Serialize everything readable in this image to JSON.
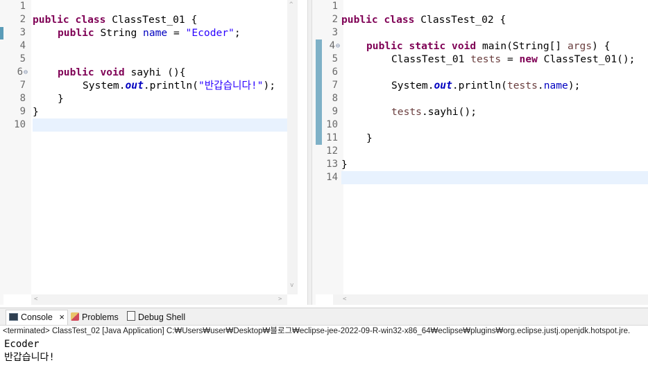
{
  "left_editor": {
    "line_numbers": [
      "1",
      "2",
      "3",
      "4",
      "5",
      "6",
      "7",
      "8",
      "9",
      "10"
    ],
    "code": {
      "l2": {
        "kw1": "public",
        "kw2": "class",
        "name": "ClassTest_01 {"
      },
      "l3": {
        "kw1": "public",
        "type": "String ",
        "field": "name",
        "eq": " = ",
        "str": "\"Ecoder\"",
        "end": ";"
      },
      "l6": {
        "kw1": "public",
        "kw2": "void",
        "rest": " sayhi (){"
      },
      "l7": {
        "obj": "System.",
        "sfield": "out",
        "call": ".println(",
        "str": "\"반갑습니다!\"",
        "end": ");"
      },
      "l8": "}",
      "l9": "}"
    }
  },
  "right_editor": {
    "line_numbers": [
      "1",
      "2",
      "3",
      "4",
      "5",
      "6",
      "7",
      "8",
      "9",
      "10",
      "11",
      "12",
      "13",
      "14"
    ],
    "code": {
      "l2": {
        "kw1": "public",
        "kw2": "class",
        "name": "ClassTest_02 {"
      },
      "l4": {
        "kw1": "public",
        "kw2": "static",
        "kw3": "void",
        "rest": " main(String[] ",
        "param": "args",
        "end": ") {"
      },
      "l5": {
        "type": "ClassTest_01 ",
        "var": "tests",
        "eq": " = ",
        "kw": "new",
        "rest": " ClassTest_01();"
      },
      "l7": {
        "obj": "System.",
        "sfield": "out",
        "call": ".println(",
        "var": "tests",
        "dot": ".",
        "field": "name",
        "end": ");"
      },
      "l9": {
        "var": "tests",
        "rest": ".sayhi();"
      },
      "l11": "}",
      "l13": "}"
    }
  },
  "console": {
    "tabs": [
      "Console",
      "Problems",
      "Debug Shell"
    ],
    "close_glyph": "×",
    "status": "<terminated> ClassTest_02 [Java Application] C:₩Users₩user₩Desktop₩블로그₩eclipse-jee-2022-09-R-win32-x86_64₩eclipse₩plugins₩org.eclipse.justj.openjdk.hotspot.jre.",
    "output": [
      "Ecoder",
      "반갑습니다!"
    ]
  },
  "icons": {
    "fold": "⊖",
    "scroll_up": "^",
    "scroll_down": "v",
    "scroll_left": "<",
    "scroll_right": ">"
  }
}
